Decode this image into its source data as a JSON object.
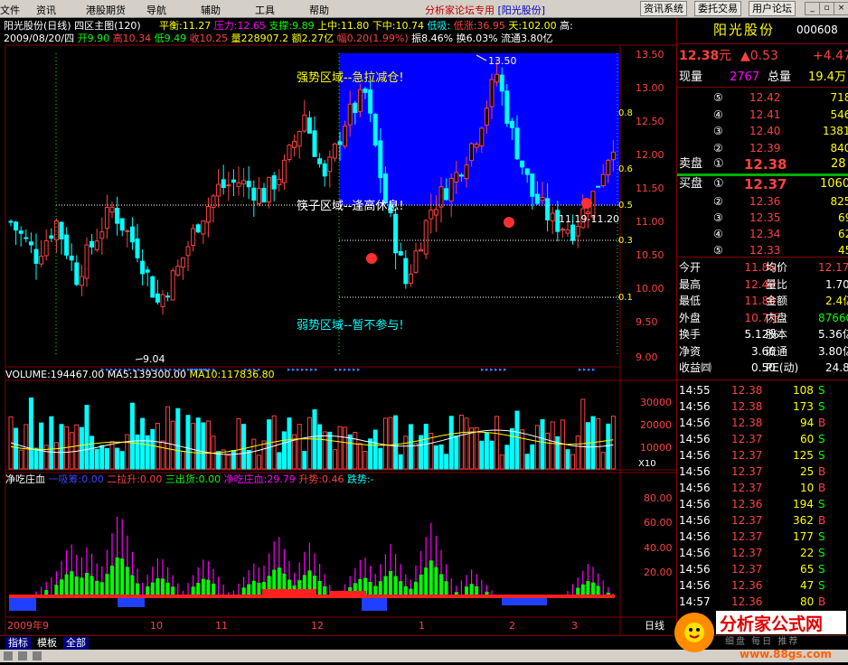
{
  "menu": {
    "items": [
      "文件",
      "资讯",
      "港股期货",
      "导航",
      "辅助",
      "工具",
      "帮助"
    ],
    "promo_text": "分析家论坛专用",
    "promo_stock": "[阳光股份]",
    "buttons": [
      "资讯系统",
      "委托交易",
      "用户论坛"
    ]
  },
  "header": {
    "title_line": "阳光股份(日线) 四区主图(120)",
    "indicator_parts": [
      {
        "text": "平衡:11.27",
        "color": "#ffff00"
      },
      {
        "text": "压力:12.65",
        "color": "#ff00ff"
      },
      {
        "text": "支撑:9.89",
        "color": "#00ff00"
      },
      {
        "text": "上中:11.80",
        "color": "#ffff00"
      },
      {
        "text": "下中:10.74",
        "color": "#ffff00"
      },
      {
        "text": "低吸:",
        "color": "#00ffff"
      },
      {
        "text": "低涨:36.95",
        "color": "#ff4040"
      },
      {
        "text": "天:102.00",
        "color": "#ffff00"
      },
      {
        "text": "高:",
        "color": "#ffffff"
      }
    ],
    "ohlc_parts": [
      {
        "text": "2009/08/20/四",
        "color": "#ffffff"
      },
      {
        "text": "开9.90",
        "color": "#00ff00"
      },
      {
        "text": "高10.34",
        "color": "#ff4040"
      },
      {
        "text": "低9.49",
        "color": "#00ff00"
      },
      {
        "text": "收10.25",
        "color": "#ff4040"
      },
      {
        "text": "量228907.2",
        "color": "#ffff00"
      },
      {
        "text": "额2.27亿",
        "color": "#ffff00"
      },
      {
        "text": "幅0.20(1.99%)",
        "color": "#ff4040"
      },
      {
        "text": "振8.46%",
        "color": "#ffffff"
      },
      {
        "text": "换6.03%",
        "color": "#ffffff"
      },
      {
        "text": "流通3.80亿",
        "color": "#ffffff"
      }
    ]
  },
  "price_panel": {
    "y_ticks": [
      "13.50",
      "13.00",
      "12.50",
      "12.00",
      "11.50",
      "11.00",
      "10.50",
      "10.00",
      "9.50",
      "9.00"
    ],
    "ratio_ticks": [
      "0.8",
      "0.6",
      "0.5",
      "0.3",
      "0.1"
    ],
    "annotations": {
      "strong_zone": "强势区域--急拉减仓!",
      "mid_zone": "筷子区域--逢高休息!",
      "weak_zone": "弱势区域--暂不参与!",
      "high_label": "13.50",
      "low_label": "9.04",
      "range_label": "11.19-11.20"
    }
  },
  "volume_panel": {
    "header_parts": [
      {
        "text": "VOLUME:194467.00",
        "color": "#ffffff"
      },
      {
        "text": "MA5:139300.00",
        "color": "#ffffff"
      },
      {
        "text": "MA10:117836.80",
        "color": "#ffff00"
      }
    ],
    "y_ticks": [
      "30000",
      "20000",
      "10000"
    ],
    "unit": "X10"
  },
  "indicator_panel": {
    "header_parts": [
      {
        "text": "净吃庄血",
        "color": "#ffffff"
      },
      {
        "text": "一吸筹:0.00",
        "color": "#4040ff"
      },
      {
        "text": "二拉升:0.00",
        "color": "#ff4040"
      },
      {
        "text": "三出货:0.00",
        "color": "#00ff00"
      },
      {
        "text": "净吃庄血:29.79",
        "color": "#ff00ff"
      },
      {
        "text": "升势:0.46",
        "color": "#ff4040"
      },
      {
        "text": "跌势:-",
        "color": "#00ffff"
      }
    ],
    "y_ticks": [
      "80.00",
      "60.00",
      "40.00",
      "20.00"
    ]
  },
  "x_axis": {
    "labels": [
      "2009年9",
      "10",
      "11",
      "12",
      "1",
      "2",
      "3"
    ]
  },
  "quote": {
    "name": "阳光股份",
    "code": "000608",
    "price": "12.38",
    "unit": "元",
    "change": "▲0.53",
    "pct": "+4.47",
    "volume_label": "现量",
    "volume": "2767",
    "total_label": "总量",
    "total": "19.4万",
    "asks": [
      {
        "lvl": "⑤",
        "price": "12.42",
        "vol": "718"
      },
      {
        "lvl": "④",
        "price": "12.41",
        "vol": "546"
      },
      {
        "lvl": "③",
        "price": "12.40",
        "vol": "1381"
      },
      {
        "lvl": "②",
        "price": "12.39",
        "vol": "840"
      }
    ],
    "ask1": {
      "label": "卖盘",
      "lvl": "①",
      "price": "12.38",
      "vol": "28"
    },
    "bid1": {
      "label": "买盘",
      "lvl": "①",
      "price": "12.37",
      "vol": "1060"
    },
    "bids": [
      {
        "lvl": "②",
        "price": "12.36",
        "vol": "825"
      },
      {
        "lvl": "③",
        "price": "12.35",
        "vol": "69"
      },
      {
        "lvl": "④",
        "price": "12.34",
        "vol": "62"
      },
      {
        "lvl": "⑤",
        "price": "12.33",
        "vol": "45"
      }
    ],
    "stats": [
      {
        "l1": "今开",
        "v1": "11.86",
        "c1": "#ff4040",
        "l2": "均价",
        "v2": "12.17",
        "c2": "#ff4040"
      },
      {
        "l1": "最高",
        "v1": "12.40",
        "c1": "#ff4040",
        "l2": "量比",
        "v2": "1.70",
        "c2": "#ffffff"
      },
      {
        "l1": "最低",
        "v1": "11.86",
        "c1": "#ff4040",
        "l2": "金额",
        "v2": "2.4亿",
        "c2": "#ffff00"
      },
      {
        "l1": "外盘",
        "v1": "10.7万",
        "c1": "#ff4040",
        "l2": "内盘",
        "v2": "87660",
        "c2": "#00ff00"
      },
      {
        "l1": "换手",
        "v1": "5.12%",
        "c1": "#ffffff",
        "l2": "股本",
        "v2": "5.36亿",
        "c2": "#ffffff"
      },
      {
        "l1": "净资",
        "v1": "3.66",
        "c1": "#ffffff",
        "l2": "流通",
        "v2": "3.80亿",
        "c2": "#ffffff"
      },
      {
        "l1": "收益㈣",
        "v1": "0.50",
        "c1": "#ffffff",
        "l2": "PE(动)",
        "v2": "24.8",
        "c2": "#ffffff"
      }
    ],
    "ticks": [
      {
        "t": "14:55",
        "p": "12.38",
        "v": "108",
        "d": "S"
      },
      {
        "t": "14:56",
        "p": "12.38",
        "v": "173",
        "d": "S"
      },
      {
        "t": "14:56",
        "p": "12.38",
        "v": "94",
        "d": "B"
      },
      {
        "t": "14:56",
        "p": "12.37",
        "v": "60",
        "d": "S"
      },
      {
        "t": "14:56",
        "p": "12.37",
        "v": "125",
        "d": "S"
      },
      {
        "t": "14:56",
        "p": "12.37",
        "v": "25",
        "d": "B"
      },
      {
        "t": "14:56",
        "p": "12.37",
        "v": "10",
        "d": "B"
      },
      {
        "t": "14:56",
        "p": "12.36",
        "v": "194",
        "d": "S"
      },
      {
        "t": "14:56",
        "p": "12.37",
        "v": "362",
        "d": "B"
      },
      {
        "t": "14:56",
        "p": "12.37",
        "v": "177",
        "d": "S"
      },
      {
        "t": "14:56",
        "p": "12.37",
        "v": "22",
        "d": "S"
      },
      {
        "t": "14:56",
        "p": "12.37",
        "v": "65",
        "d": "S"
      },
      {
        "t": "14:56",
        "p": "12.36",
        "v": "47",
        "d": "S"
      },
      {
        "t": "14:57",
        "p": "12.36",
        "v": "80",
        "d": "B"
      }
    ]
  },
  "bottom_tabs": [
    "指标",
    "模板",
    "全部"
  ],
  "period_tab": "日线",
  "logo": {
    "brand": "分析家公式网",
    "url": "www.88gs.com",
    "sub": "细盘 每日 推荐"
  },
  "colors": {
    "up": "#ff4040",
    "down": "#00ffff",
    "zone": "#0000ff",
    "frame": "#800000"
  }
}
